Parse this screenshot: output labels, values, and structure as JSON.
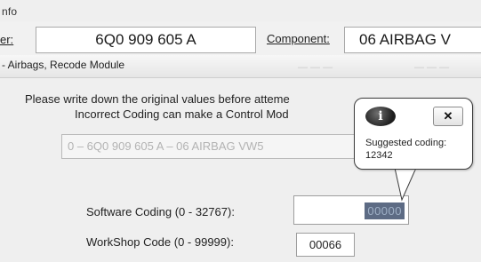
{
  "header": {
    "title_fragment": "nfo",
    "part_label": "er:",
    "part_number": "6Q0 909 605 A",
    "component_label": "Component:",
    "component_value": "06 AIRBAG V"
  },
  "breadcrumb": "- Airbags,  Recode Module",
  "instructions": {
    "line1": "Please write down the original values before atteme",
    "line2": "Incorrect Coding can make a Control Mod"
  },
  "coding_select": {
    "selected": "0 – 6Q0 909 605 A – 06 AIRBAG VW5"
  },
  "fields": {
    "software_coding_label": "Software Coding (0 - 32767):",
    "software_coding_value": "00000",
    "workshop_code_label": "WorkShop Code (0 - 99999):",
    "workshop_code_value": "00066"
  },
  "tooltip": {
    "icon": "info-icon",
    "icon_glyph": "i",
    "close_glyph": "✕",
    "title": "Suggested coding:",
    "value": "12342"
  }
}
